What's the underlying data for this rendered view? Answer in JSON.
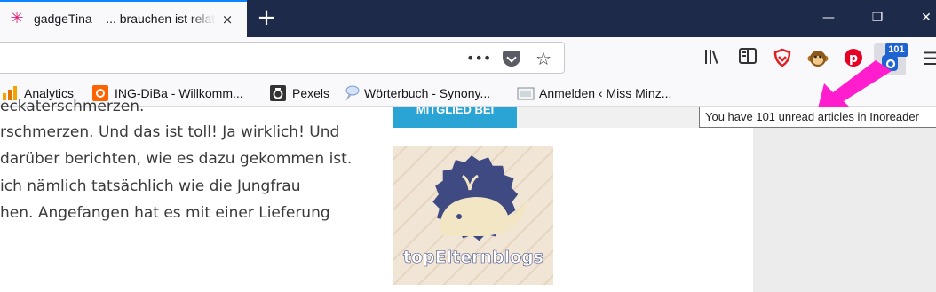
{
  "tab": {
    "title": "gadgeTina – ... brauchen ist relativ",
    "favicon": "gadgetina-star-icon",
    "close_icon": "×"
  },
  "window_controls": {
    "new_tab_icon": "+",
    "minimize": "—",
    "restore": "❐",
    "close": "✕"
  },
  "urlbar": {
    "value": "",
    "placeholder": "",
    "page_actions_icon": "•••"
  },
  "toolbar_icons": [
    "library-icon",
    "sidebar-icon",
    "ublock-shield-icon",
    "monkey-extension-icon",
    "pinterest-icon",
    "inoreader-icon",
    "menu-icon"
  ],
  "inoreader": {
    "badge": "101",
    "tooltip": "You have 101 unread articles in Inoreader"
  },
  "bookmarks": [
    {
      "label": "Analytics",
      "icon": "analytics-icon",
      "color": "#f4a300"
    },
    {
      "label": "ING-DiBa - Willkomm...",
      "icon": "ing-lion-icon",
      "color": "#ff6200"
    },
    {
      "label": "Pexels",
      "icon": "pexels-camera-icon",
      "color": "#333333"
    },
    {
      "label": "Wörterbuch - Synony...",
      "icon": "dictionary-icon",
      "color": "#7a9fd4"
    },
    {
      "label": "Anmelden ‹ Miss Minz...",
      "icon": "wordpress-frame-icon",
      "color": "#7f8a94"
    }
  ],
  "article": {
    "lines": [
      "eckaterschmerzen.",
      "rschmerzen. Und das ist toll! Ja wirklich! Und",
      " darüber berichten, wie es dazu gekommen ist.",
      " ich nämlich tatsächlich wie die Jungfrau",
      "hen. Angefangen hat es mit einer Lieferung"
    ]
  },
  "sidebar": {
    "member_button": "MITGLIED BEI",
    "badge_label": "topElternblogs"
  },
  "colors": {
    "accent": "#0a84ff",
    "tab_bar": "#1e2a4a",
    "member_button": "#2aa3d5",
    "badge_circle": "#3f4a82",
    "arrow": "#ff1dce",
    "inoreader_badge": "#1f63d0"
  }
}
